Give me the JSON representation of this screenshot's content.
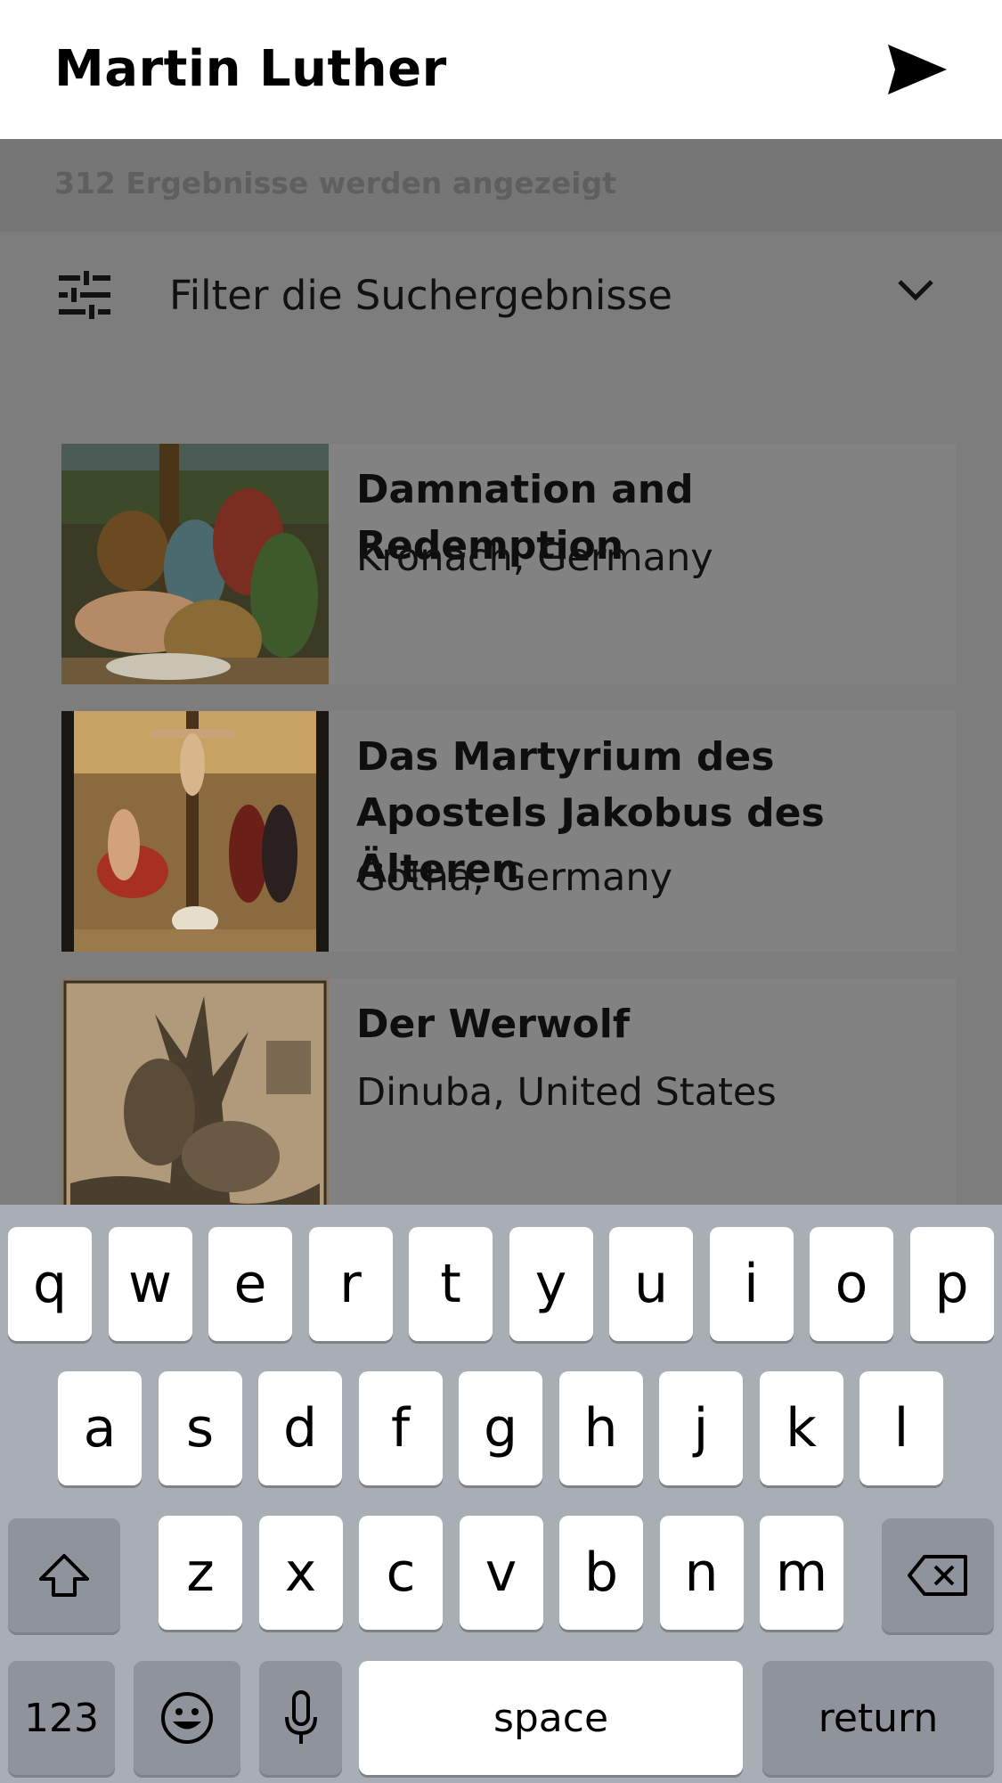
{
  "header": {
    "title": "Martin Luther",
    "send_icon": "send-icon"
  },
  "results": {
    "count_text": "312 Ergebnisse werden angezeigt",
    "filter_label": "Filter die Suchergebnisse",
    "items": [
      {
        "title": "Damnation and Redemption",
        "location": "Kronach, Germany"
      },
      {
        "title": "Das Martyrium des Apostels Jakobus des Älteren",
        "location": "Gotha, Germany"
      },
      {
        "title": "Der Werwolf",
        "location": "Dinuba, United States"
      }
    ]
  },
  "keyboard": {
    "row1": [
      "q",
      "w",
      "e",
      "r",
      "t",
      "y",
      "u",
      "i",
      "o",
      "p"
    ],
    "row2": [
      "a",
      "s",
      "d",
      "f",
      "g",
      "h",
      "j",
      "k",
      "l"
    ],
    "row3": [
      "z",
      "x",
      "c",
      "v",
      "b",
      "n",
      "m"
    ],
    "numbers_label": "123",
    "space_label": "space",
    "return_label": "return"
  },
  "colors": {
    "header_bg": "#ffffff",
    "dim_bg": "#7f7f7f",
    "keyboard_bg": "#a9adb4",
    "key_bg": "#ffffff",
    "key_dark_bg": "#8f939b"
  }
}
